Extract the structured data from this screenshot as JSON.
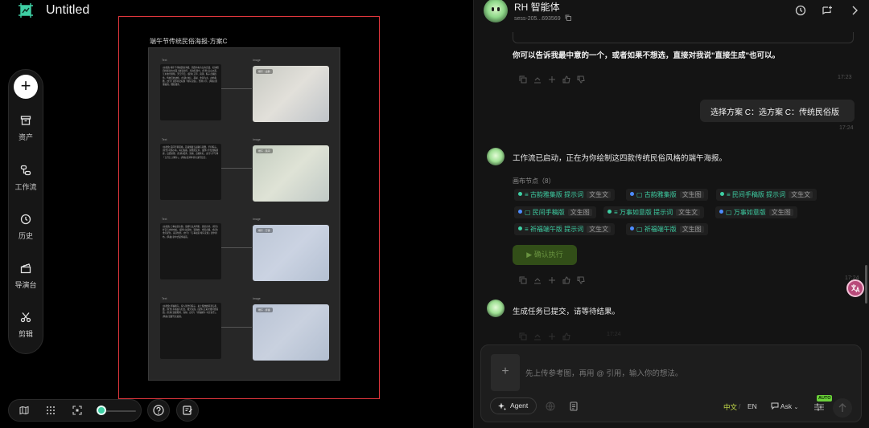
{
  "app": {
    "title": "Untitled"
  },
  "side_toolbar": {
    "items": [
      {
        "label": "资产",
        "icon": "archive-icon"
      },
      {
        "label": "工作流",
        "icon": "workflow-icon"
      },
      {
        "label": "历史",
        "icon": "clock-icon"
      },
      {
        "label": "导演台",
        "icon": "clapperboard-icon"
      },
      {
        "label": "剪辑",
        "icon": "scissors-icon"
      }
    ]
  },
  "canvas": {
    "board_title": "端午节传统民俗海报-方案C",
    "node_groups": [
      {
        "text_label": "Text",
        "image_label": "Image",
        "image_tag": "端午 · 古韵",
        "text": "[主视觉] 端午节传统民俗海报，画面中央为龙舟竞渡，红绿相间的船身在水面上破浪前行，岸边有观众。[背景] 远山淡墨，江水波光粼粼，天空浮云。[装饰] 艾草、菖蒲、粽子点缀四角，传统云纹边框。[色调] 朱红、墨绿、金黄为主，古朴典雅。[文字] 顶部书法标题「端午安康」，竖排小字。[风格] 国潮插画，细腻线条。"
      },
      {
        "text_label": "Text",
        "image_label": "Image",
        "image_tag": "端午 · 民间",
        "text": "[主视觉] 民间手稿风格，孩童佩戴五彩绳与香囊，手持粽子。[背景] 村落小巷，青石板路，屋檐挂艾草。[装饰] 手绘线稿质感，旧纸纹理。[色调] 暖黄、浅褐、点缀朱红。[文字] 手写体「五月五 过端午」。[风格] 民间年画与速写结合。"
      },
      {
        "text_label": "Text",
        "image_label": "Image",
        "image_tag": "端午 · 万事",
        "text": "[主视觉] 万事如意主题，锦鲤与龙舟同框，寓意吉祥。[背景] 祥云与水纹交织。[装饰] 如意纹、铜钱纹、金箔点缀。[色调] 金红配色，喜庆热烈。[文字] 「万事如意 端午安康」居中排布。[风格] 新中式装饰插画。"
      },
      {
        "text_label": "Text",
        "image_label": "Image",
        "image_tag": "端午 · 祈福",
        "text": "[主视觉] 祈福端午，家人围坐包粽子，桌上摆放雄黄酒与香囊。[背景] 木格窗与灯笼，暖光氛围。[装饰] 五彩丝线环绕画面。[色调] 温暖橙黄、深绿。[文字] 「祈福端午 平安喜乐」。[风格] 温馨写实插画。"
      }
    ]
  },
  "chat": {
    "agent_name": "RH 智能体",
    "session_id": "sess-205...693569",
    "messages": {
      "prompt_text": "你可以告诉我最中意的一个，或者如果不想选，直接对我说\"直接生成\"也可以。",
      "prompt_time": "17:23",
      "user_text": "选择方案 C：选方案 C：传统民俗版",
      "user_time": "17:24",
      "workflow_text": "工作流已启动，正在为你绘制这四款传统民俗风格的端午海报。",
      "nodes_label": "画布节点（8）",
      "confirm_label": "确认执行",
      "confirm_time": "17:24",
      "submitted_text": "生成任务已提交，请等待结果。",
      "submitted_time": "17:24"
    },
    "nodes": [
      {
        "name": "古韵雅集版 提示词",
        "kind": "文生文",
        "dot": "#3ecfa4"
      },
      {
        "name": "古韵雅集版",
        "kind": "文生图",
        "dot": "#4d8cff"
      },
      {
        "name": "民间手稿版 提示词",
        "kind": "文生文",
        "dot": "#3ecfa4"
      },
      {
        "name": "民间手稿版",
        "kind": "文生图",
        "dot": "#4d8cff"
      },
      {
        "name": "万事如意版 提示词",
        "kind": "文生文",
        "dot": "#3ecfa4"
      },
      {
        "name": "万事如意版",
        "kind": "文生图",
        "dot": "#4d8cff"
      },
      {
        "name": "祈福端午版 提示词",
        "kind": "文生文",
        "dot": "#3ecfa4"
      },
      {
        "name": "祈福端午版",
        "kind": "文生图",
        "dot": "#4d8cff"
      }
    ],
    "composer": {
      "placeholder": "先上传参考图，再用 @ 引用，输入你的想法。",
      "agent_label": "Agent",
      "lang_zh": "中文",
      "lang_en": "EN",
      "ask_label": "Ask",
      "auto_badge": "AUTO"
    }
  },
  "colors": {
    "accent": "#3ecfa4",
    "selection": "#e0363c",
    "lang_active": "#c8e04a",
    "auto_badge": "#6bd23a"
  }
}
